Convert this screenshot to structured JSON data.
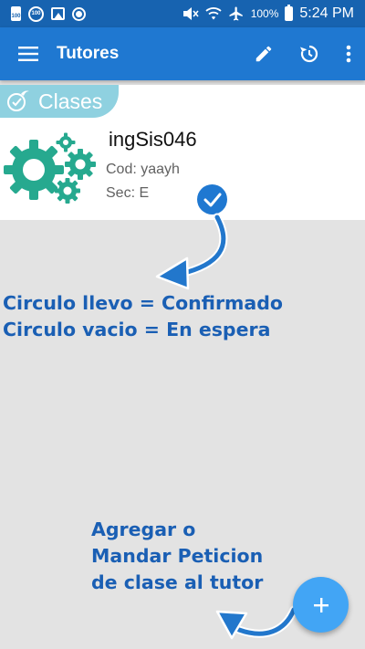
{
  "status_bar": {
    "battery_level": "100%",
    "time": "5:24 PM",
    "icons": [
      "battery-saver-icon",
      "storage-100-icon",
      "image-icon",
      "record-icon",
      "mute-icon",
      "wifi-icon",
      "airplane-icon",
      "battery-icon"
    ]
  },
  "app_bar": {
    "title": "Tutores",
    "icons": [
      "menu-icon",
      "edit-icon",
      "history-icon",
      "more-vert-icon"
    ]
  },
  "section": {
    "label": "Clases",
    "icon": "check-swoosh-icon"
  },
  "class_card": {
    "name": "ingSis046",
    "code_label": "Cod:",
    "code_value": "yaayh",
    "sec_label": "Sec:",
    "sec_value": "E",
    "status": "confirmed",
    "image": "gears-icon"
  },
  "annotations": {
    "status_line_1": "Circulo llevo = Confirmado",
    "status_line_2": "Circulo vacio = En espera",
    "fab_line_1": "Agregar o",
    "fab_line_2": "Mandar Peticion",
    "fab_line_3": "de clase al tutor"
  },
  "fab": {
    "icon": "plus-icon"
  },
  "colors": {
    "status_bar": "#1763b0",
    "app_bar": "#1f78d1",
    "section_chip": "#8fd1e0",
    "gear": "#26a98f",
    "annotation_text": "#1a5fb4",
    "fab": "#42a5f5",
    "background": "#e3e3e3"
  }
}
